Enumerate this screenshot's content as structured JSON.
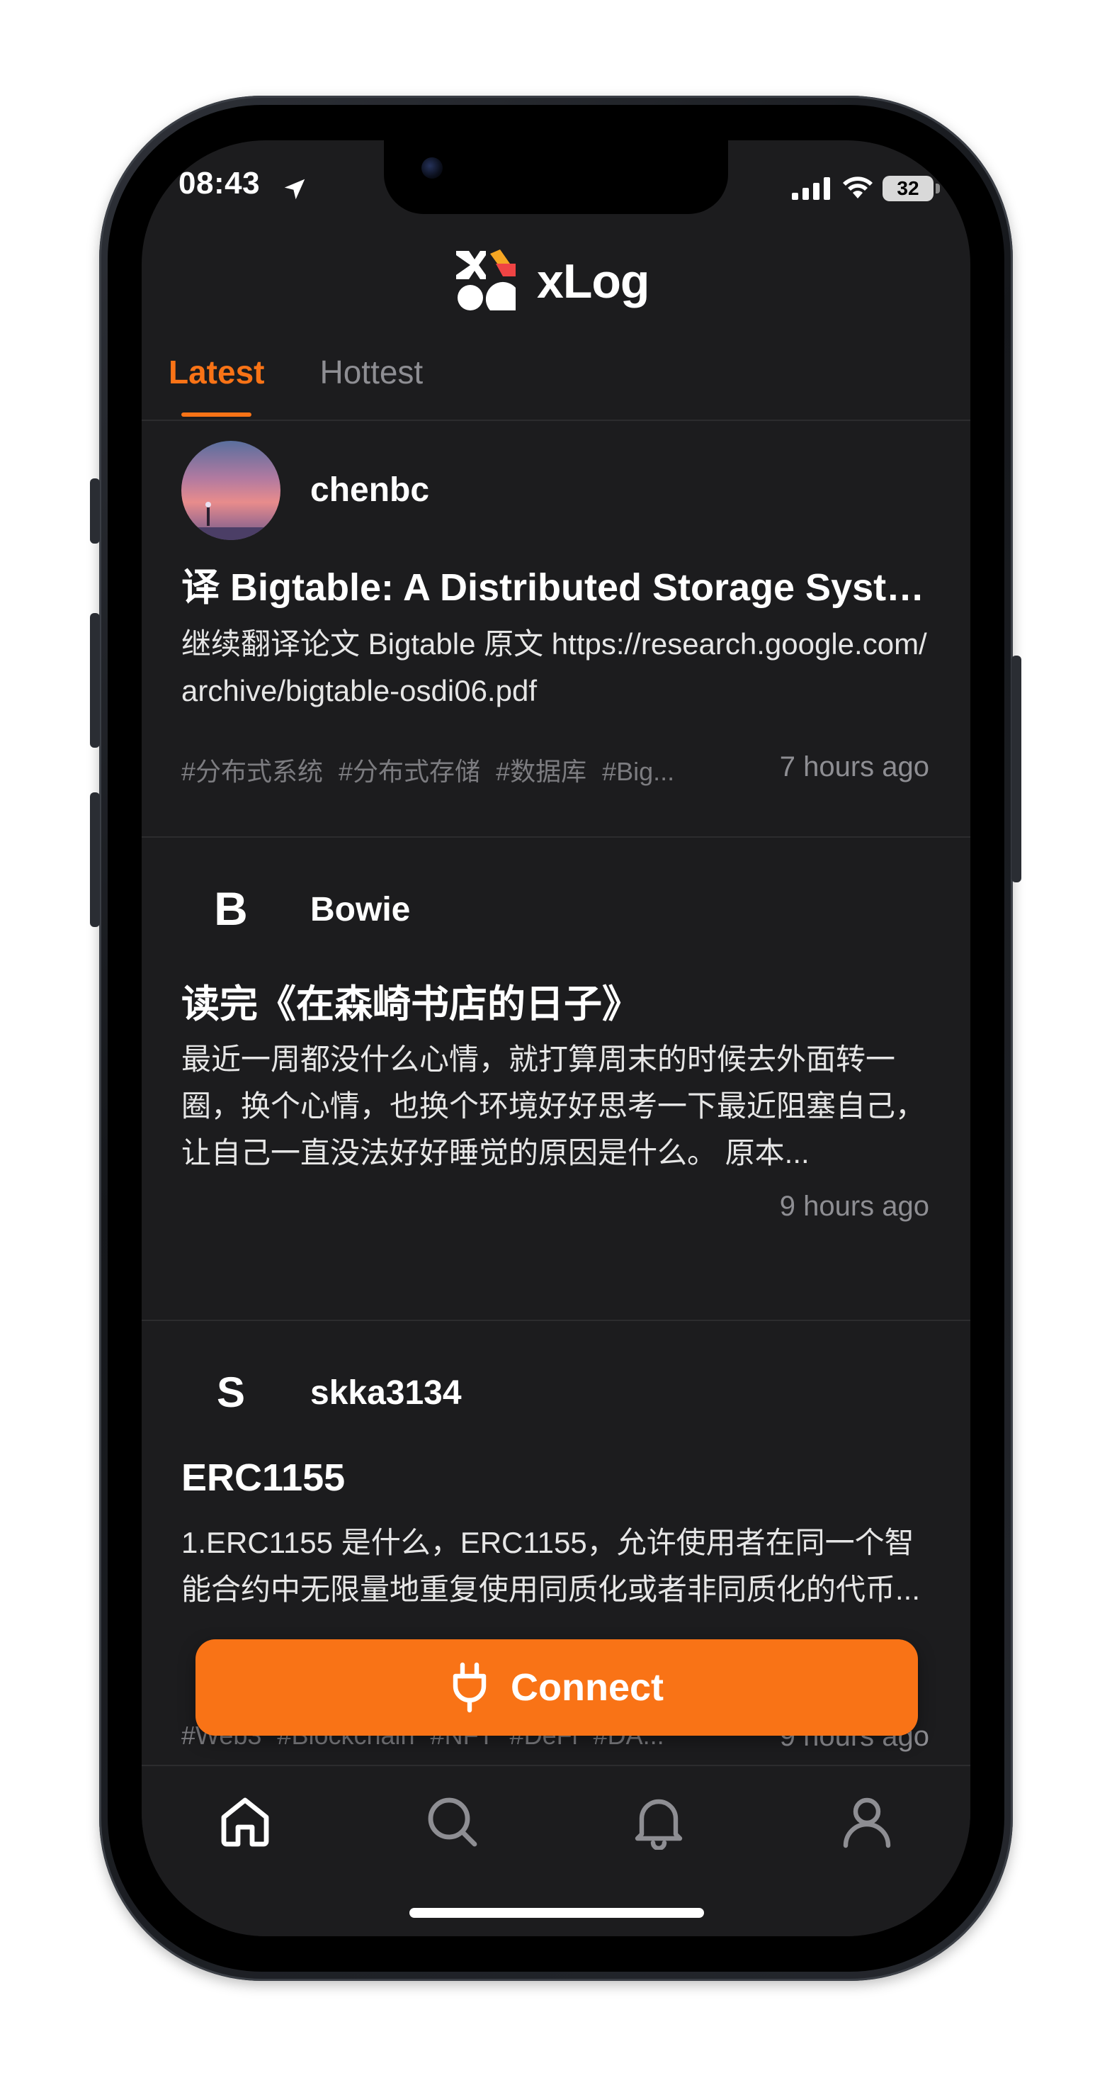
{
  "status_bar": {
    "time": "08:43",
    "battery": "32"
  },
  "header": {
    "brand": "xLog"
  },
  "tabs": [
    {
      "label": "Latest",
      "active": true
    },
    {
      "label": "Hottest",
      "active": false
    }
  ],
  "posts": [
    {
      "author": "chenbc",
      "avatar_type": "photo",
      "title": "译 Bigtable: A Distributed Storage System for Structured Data",
      "excerpt": "继续翻译论文 Bigtable 原文 https://research.google.com/archive/bigtable-osdi06.pdf",
      "tags": [
        "#分布式系统",
        "#分布式存储",
        "#数据库",
        "#Big..."
      ],
      "time_ago": "7 hours ago"
    },
    {
      "author": "Bowie",
      "avatar_letter": "B",
      "title": "读完《在森崎书店的日子》",
      "excerpt": "最近一周都没什么心情，就打算周末的时候去外面转一圈，换个心情，也换个环境好好思考一下最近阻塞自己，让自己一直没法好好睡觉的原因是什么。 原本...",
      "tags": [],
      "time_ago": "9 hours ago"
    },
    {
      "author": "skka3134",
      "avatar_letter": "S",
      "title": "ERC1155",
      "excerpt": "1.ERC1155 是什么，ERC1155，允许使用者在同一个智能合约中无限量地重复使用同质化或者非同质化的代币...",
      "tags": [
        "#Web3",
        "#Blockchain",
        "#NFT",
        "#DeFi",
        "#DA..."
      ],
      "time_ago": "9 hours ago"
    }
  ],
  "connect_button": {
    "label": "Connect"
  },
  "bottom_nav": [
    {
      "icon": "home-icon",
      "active": true
    },
    {
      "icon": "search-icon",
      "active": false
    },
    {
      "icon": "bell-icon",
      "active": false
    },
    {
      "icon": "user-icon",
      "active": false
    }
  ],
  "colors": {
    "accent": "#f97316",
    "background": "#1c1c1e",
    "muted": "#8e8e93"
  }
}
